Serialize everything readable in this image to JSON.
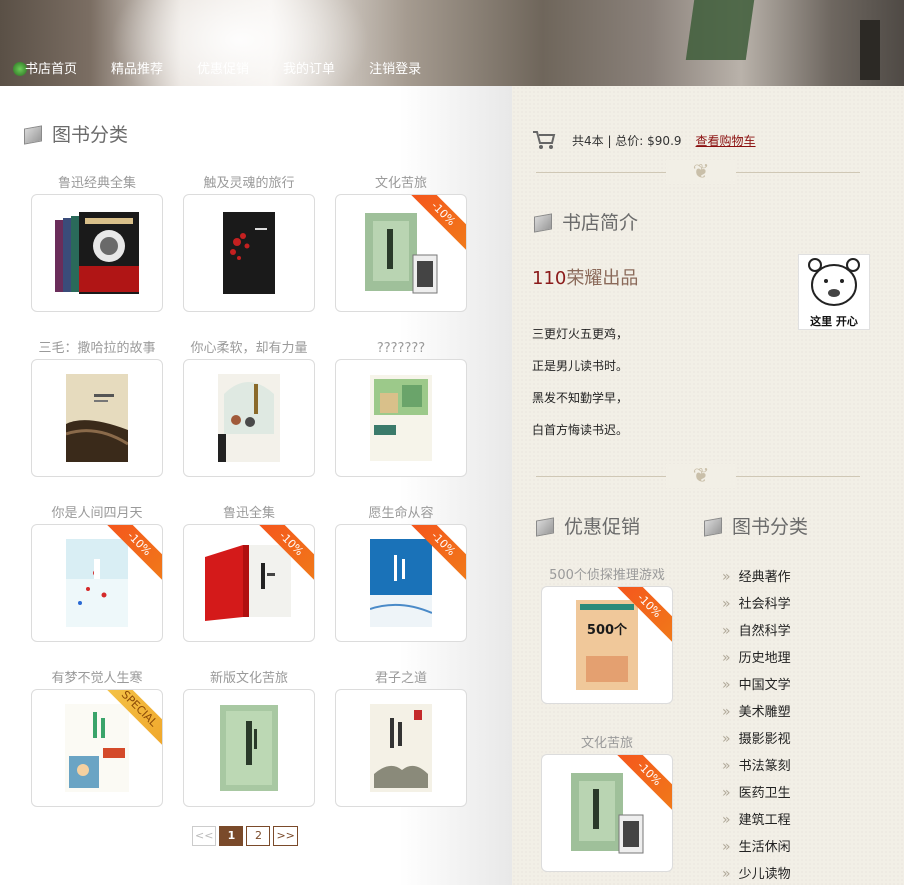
{
  "nav": {
    "items": [
      {
        "label": "书店首页"
      },
      {
        "label": "精品推荐"
      },
      {
        "label": "优惠促销"
      },
      {
        "label": "我的订单"
      },
      {
        "label": "注销登录"
      }
    ]
  },
  "left": {
    "section_title": "图书分类",
    "books": [
      {
        "title": "鲁迅经典全集",
        "badge": ""
      },
      {
        "title": "触及灵魂的旅行",
        "badge": ""
      },
      {
        "title": "文化苦旅",
        "badge": "-10%"
      },
      {
        "title": "三毛：撒哈拉的故事",
        "badge": ""
      },
      {
        "title": "你心柔软，却有力量",
        "badge": ""
      },
      {
        "title": "???????",
        "badge": ""
      },
      {
        "title": "你是人间四月天",
        "badge": "-10%"
      },
      {
        "title": "鲁迅全集",
        "badge": "-10%"
      },
      {
        "title": "愿生命从容",
        "badge": "-10%"
      },
      {
        "title": "有梦不觉人生寒",
        "badge": "SPECIAL"
      },
      {
        "title": "新版文化苦旅",
        "badge": ""
      },
      {
        "title": "君子之道",
        "badge": ""
      }
    ],
    "pager": {
      "prev": "<<",
      "pages": [
        "1",
        "2"
      ],
      "next": ">>",
      "current": "1"
    }
  },
  "right": {
    "cart": {
      "summary": "共4本 | 总价: $90.9",
      "link": "查看购物车"
    },
    "intro": {
      "title": "书店简介",
      "headline_num": "110",
      "headline_text": "荣耀出品",
      "poem": [
        "三更灯火五更鸡，",
        "正是男儿读书时。",
        "黑发不知勤学早，",
        "白首方悔读书迟。"
      ],
      "bear_caption": "这里 开心"
    },
    "promo": {
      "title": "优惠促销",
      "items": [
        {
          "title": "500个侦探推理游戏",
          "badge": "-10%",
          "cover_text": "500个侦探推理游戏"
        },
        {
          "title": "文化苦旅",
          "badge": "-10%"
        }
      ]
    },
    "categories": {
      "title": "图书分类",
      "items": [
        "经典著作",
        "社会科学",
        "自然科学",
        "历史地理",
        "中国文学",
        "美术雕塑",
        "摄影影视",
        "书法篆刻",
        "医药卫生",
        "建筑工程",
        "生活休闲",
        "少儿读物"
      ]
    }
  }
}
